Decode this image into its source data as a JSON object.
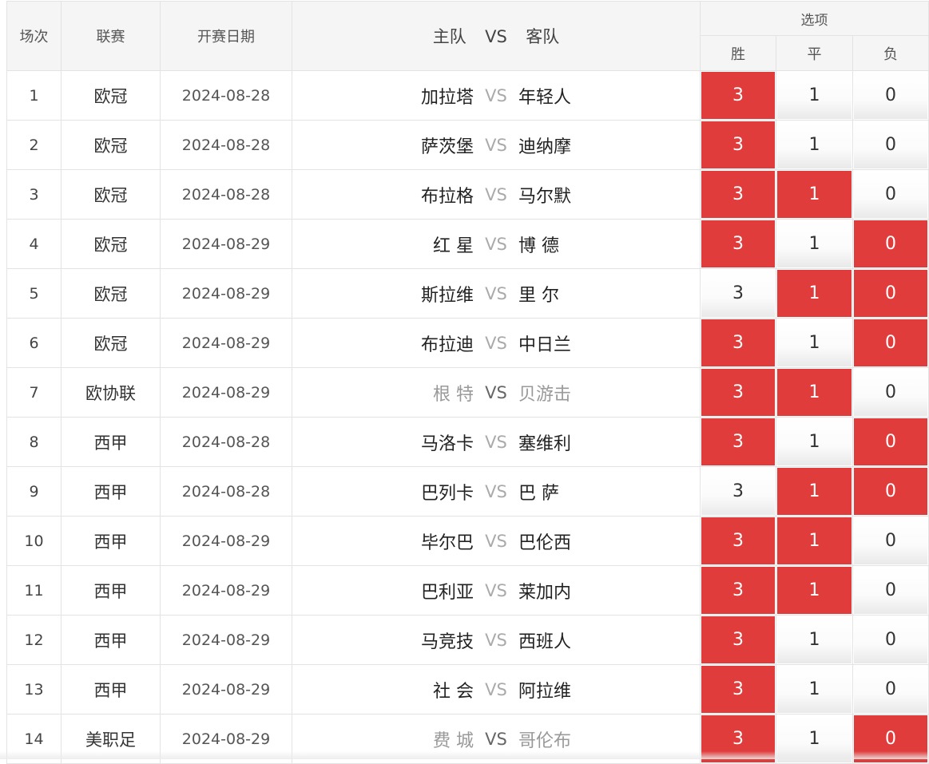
{
  "headers": {
    "index": "场次",
    "league": "联赛",
    "date": "开赛日期",
    "home": "主队",
    "vs": "VS",
    "away": "客队",
    "options": "选项",
    "win": "胜",
    "draw": "平",
    "lose": "负"
  },
  "colors": {
    "selected": "#e13c3c",
    "unselected": "#ffffff"
  },
  "rows": [
    {
      "idx": "1",
      "league": "欧冠",
      "date": "2024-08-28",
      "home": "加拉塔",
      "vs": "VS",
      "away": "年轻人",
      "win": "3",
      "draw": "1",
      "lose": "0",
      "sel": [
        true,
        false,
        false
      ],
      "dim": false
    },
    {
      "idx": "2",
      "league": "欧冠",
      "date": "2024-08-28",
      "home": "萨茨堡",
      "vs": "VS",
      "away": "迪纳摩",
      "win": "3",
      "draw": "1",
      "lose": "0",
      "sel": [
        true,
        false,
        false
      ],
      "dim": false
    },
    {
      "idx": "3",
      "league": "欧冠",
      "date": "2024-08-28",
      "home": "布拉格",
      "vs": "VS",
      "away": "马尔默",
      "win": "3",
      "draw": "1",
      "lose": "0",
      "sel": [
        true,
        true,
        false
      ],
      "dim": false
    },
    {
      "idx": "4",
      "league": "欧冠",
      "date": "2024-08-29",
      "home": "红 星",
      "vs": "VS",
      "away": "博 德",
      "win": "3",
      "draw": "1",
      "lose": "0",
      "sel": [
        true,
        false,
        true
      ],
      "dim": false
    },
    {
      "idx": "5",
      "league": "欧冠",
      "date": "2024-08-29",
      "home": "斯拉维",
      "vs": "VS",
      "away": "里 尔",
      "win": "3",
      "draw": "1",
      "lose": "0",
      "sel": [
        false,
        true,
        true
      ],
      "dim": false
    },
    {
      "idx": "6",
      "league": "欧冠",
      "date": "2024-08-29",
      "home": "布拉迪",
      "vs": "VS",
      "away": "中日兰",
      "win": "3",
      "draw": "1",
      "lose": "0",
      "sel": [
        true,
        false,
        true
      ],
      "dim": false
    },
    {
      "idx": "7",
      "league": "欧协联",
      "date": "2024-08-29",
      "home": "根 特",
      "vs": "VS",
      "away": "贝游击",
      "win": "3",
      "draw": "1",
      "lose": "0",
      "sel": [
        true,
        true,
        false
      ],
      "dim": true
    },
    {
      "idx": "8",
      "league": "西甲",
      "date": "2024-08-28",
      "home": "马洛卡",
      "vs": "VS",
      "away": "塞维利",
      "win": "3",
      "draw": "1",
      "lose": "0",
      "sel": [
        true,
        false,
        true
      ],
      "dim": false
    },
    {
      "idx": "9",
      "league": "西甲",
      "date": "2024-08-28",
      "home": "巴列卡",
      "vs": "VS",
      "away": "巴 萨",
      "win": "3",
      "draw": "1",
      "lose": "0",
      "sel": [
        false,
        true,
        true
      ],
      "dim": false
    },
    {
      "idx": "10",
      "league": "西甲",
      "date": "2024-08-29",
      "home": "毕尔巴",
      "vs": "VS",
      "away": "巴伦西",
      "win": "3",
      "draw": "1",
      "lose": "0",
      "sel": [
        true,
        true,
        false
      ],
      "dim": false
    },
    {
      "idx": "11",
      "league": "西甲",
      "date": "2024-08-29",
      "home": "巴利亚",
      "vs": "VS",
      "away": "莱加内",
      "win": "3",
      "draw": "1",
      "lose": "0",
      "sel": [
        true,
        true,
        false
      ],
      "dim": false
    },
    {
      "idx": "12",
      "league": "西甲",
      "date": "2024-08-29",
      "home": "马竞技",
      "vs": "VS",
      "away": "西班人",
      "win": "3",
      "draw": "1",
      "lose": "0",
      "sel": [
        true,
        false,
        false
      ],
      "dim": false
    },
    {
      "idx": "13",
      "league": "西甲",
      "date": "2024-08-29",
      "home": "社 会",
      "vs": "VS",
      "away": "阿拉维",
      "win": "3",
      "draw": "1",
      "lose": "0",
      "sel": [
        true,
        false,
        false
      ],
      "dim": false
    },
    {
      "idx": "14",
      "league": "美职足",
      "date": "2024-08-29",
      "home": "费 城",
      "vs": "VS",
      "away": "哥伦布",
      "win": "3",
      "draw": "1",
      "lose": "0",
      "sel": [
        true,
        false,
        true
      ],
      "dim": true
    }
  ]
}
